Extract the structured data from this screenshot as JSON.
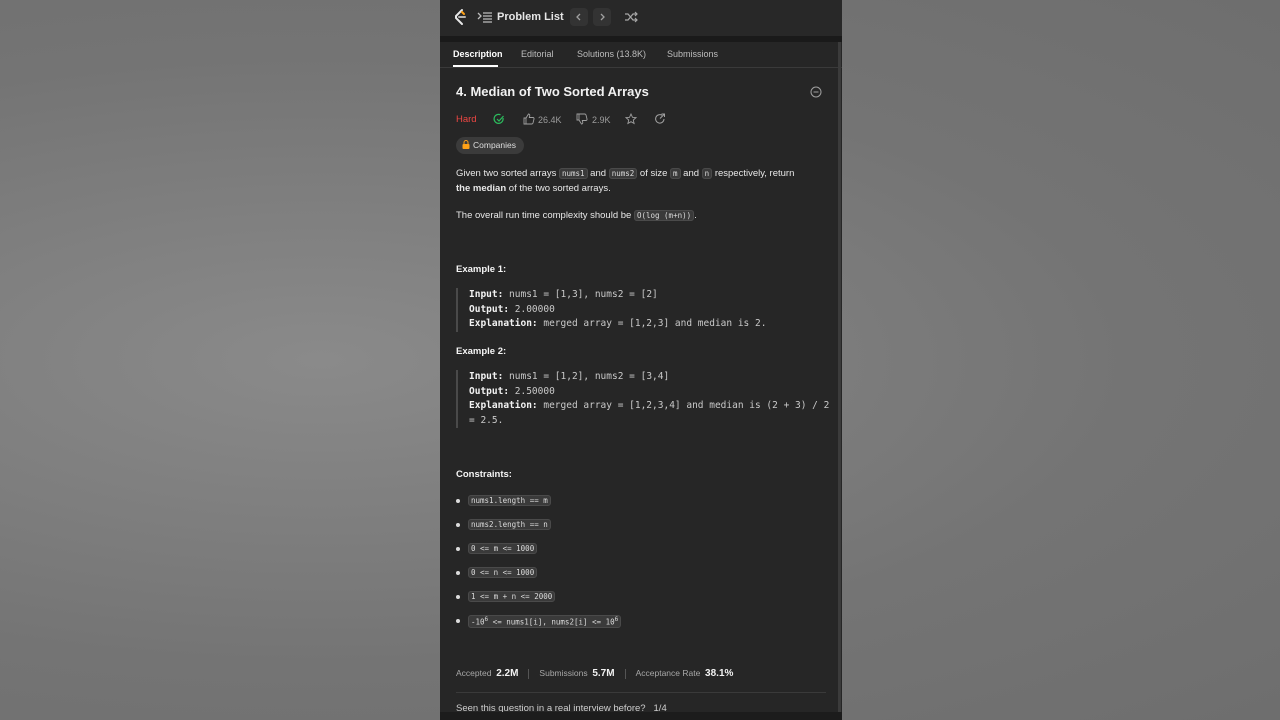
{
  "topbar": {
    "title": "Problem List"
  },
  "tabs": [
    "Description",
    "Editorial",
    "Solutions (13.8K)",
    "Submissions"
  ],
  "problem": {
    "title": "4. Median of Two Sorted Arrays",
    "difficulty": "Hard",
    "likes": "26.4K",
    "dislikes": "2.9K",
    "companies": "Companies",
    "desc1_a": "Given two sorted arrays ",
    "desc1_code1": "nums1",
    "desc1_b": " and ",
    "desc1_code2": "nums2",
    "desc1_c": " of size ",
    "desc1_code3": "m",
    "desc1_d": " and ",
    "desc1_code4": "n",
    "desc1_e": " respectively, return",
    "desc1_bold": "the median",
    "desc1_f": " of the two sorted arrays.",
    "desc2_a": "The overall run time complexity should be ",
    "desc2_code": "O(log (m+n))",
    "desc2_b": "."
  },
  "examples": [
    {
      "heading": "Example 1:",
      "input_label": "Input:",
      "input": " nums1 = [1,3], nums2 = [2]",
      "output_label": "Output:",
      "output": " 2.00000",
      "explanation_label": "Explanation:",
      "explanation": " merged array = [1,2,3] and median is 2."
    },
    {
      "heading": "Example 2:",
      "input_label": "Input:",
      "input": " nums1 = [1,2], nums2 = [3,4]",
      "output_label": "Output:",
      "output": " 2.50000",
      "explanation_label": "Explanation:",
      "explanation": " merged array = [1,2,3,4] and median is (2 + 3) / 2 = 2.5."
    }
  ],
  "constraints": {
    "heading": "Constraints:",
    "items": [
      "nums1.length == m",
      "nums2.length == n",
      "0 <= m <= 1000",
      "0 <= n <= 1000",
      "1 <= m + n <= 2000"
    ],
    "last_prefix": "-10",
    "last_sup1": "6",
    "last_mid": " <= nums1[i], nums2[i] <= 10",
    "last_sup2": "6"
  },
  "stats": {
    "accepted_label": "Accepted",
    "accepted": "2.2M",
    "submissions_label": "Submissions",
    "submissions": "5.7M",
    "rate_label": "Acceptance Rate",
    "rate": "38.1%"
  },
  "interview": {
    "text": "Seen this question in a real interview before?",
    "count": "1/4"
  },
  "colors": {
    "hard": "#ef4743",
    "solved": "#2cbb5d",
    "logo": "#ffa116"
  }
}
